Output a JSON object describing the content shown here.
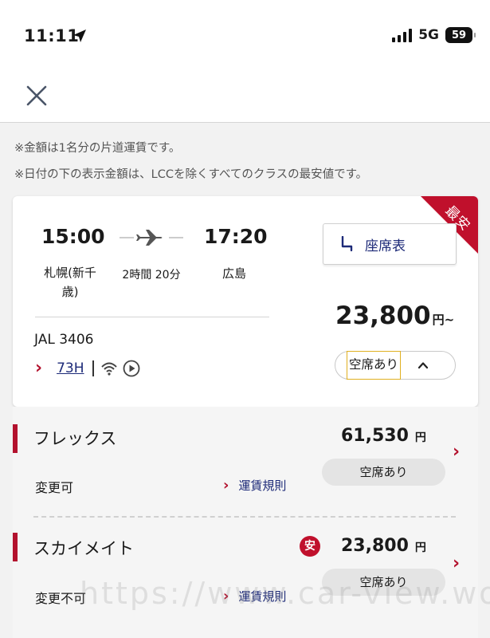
{
  "status_bar": {
    "time": "11:11",
    "network": "5G",
    "battery": "59"
  },
  "header": {
    "close_icon": "close-icon"
  },
  "notes": [
    "※金額は1名分の片道運賃です。",
    "※日付の下の表示金額は、LCCを除くすべてのクラスの最安値です。"
  ],
  "flight": {
    "badge": "最安",
    "departure_time": "15:00",
    "arrival_time": "17:20",
    "departure_place": "札幌(新千歳)",
    "duration": "2時間 20分",
    "arrival_place": "広島",
    "flight_number": "JAL 3406",
    "aircraft": "73H",
    "seat_map_label": "座席表",
    "price": "23,800",
    "price_unit": "円~",
    "availability": "空席あり"
  },
  "fares": [
    {
      "name": "フレックス",
      "price": "61,530",
      "unit": "円",
      "availability": "空席あり",
      "change": "変更可",
      "rules_label": "運賃規則"
    },
    {
      "name": "スカイメイト",
      "badge": "安",
      "price": "23,800",
      "unit": "円",
      "availability": "空席あり",
      "change": "変更不可",
      "rules_label": "運賃規則"
    }
  ],
  "watermark": "https://www.car-view.work",
  "colors": {
    "accent_red": "#c0102c",
    "link_navy": "#1d2a78",
    "highlight_yellow": "#e0b020"
  }
}
